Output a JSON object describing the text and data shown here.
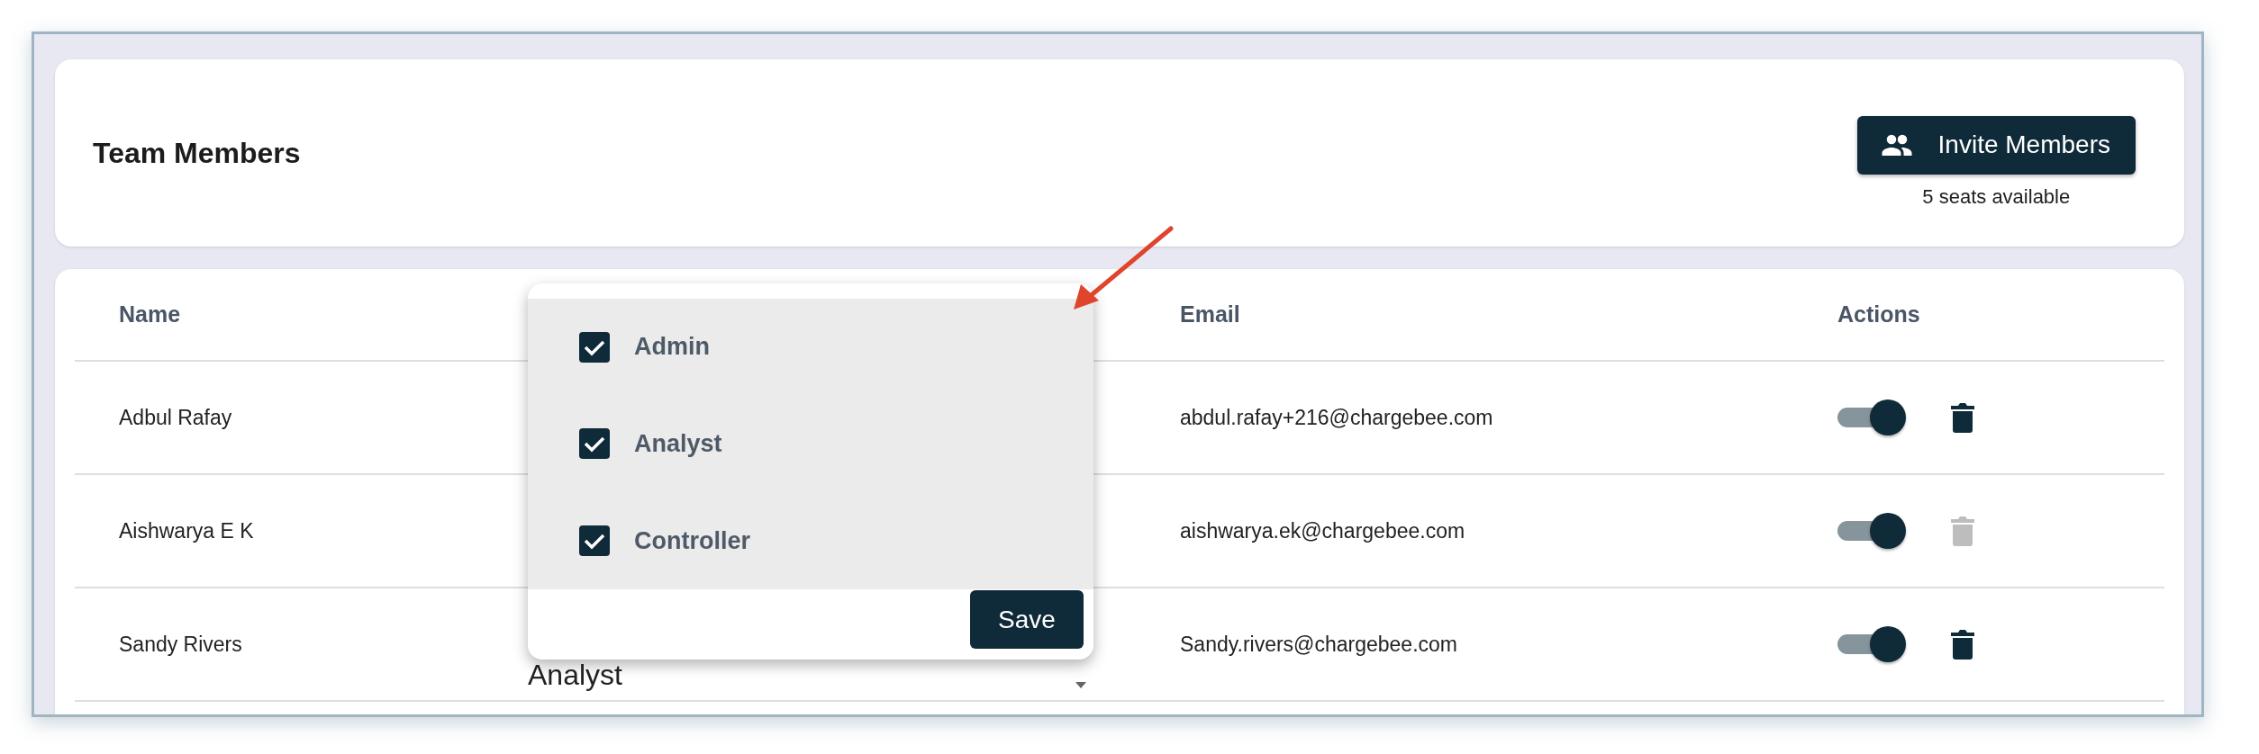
{
  "header": {
    "title": "Team Members",
    "invite_button": "Invite Members",
    "seats": "5 seats available"
  },
  "table": {
    "columns": [
      "Name",
      "",
      "Email",
      "Actions"
    ],
    "rows": [
      {
        "name": "Adbul Rafay",
        "email": "abdul.rafay+216@chargebee.com",
        "on": true,
        "delete_disabled": false
      },
      {
        "name": "Aishwarya E K",
        "email": "aishwarya.ek@chargebee.com",
        "on": true,
        "delete_disabled": true
      },
      {
        "name": "Sandy Rivers",
        "role": "Analyst",
        "email": "Sandy.rivers@chargebee.com",
        "on": true,
        "delete_disabled": false
      }
    ]
  },
  "role_menu": {
    "options": [
      {
        "label": "Admin",
        "checked": true
      },
      {
        "label": "Analyst",
        "checked": true
      },
      {
        "label": "Controller",
        "checked": true
      }
    ],
    "save_button": "Save"
  }
}
